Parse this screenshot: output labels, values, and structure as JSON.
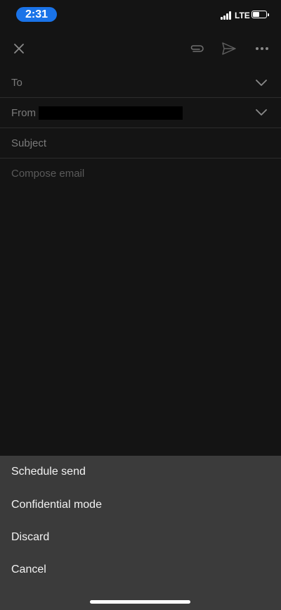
{
  "status_bar": {
    "time": "2:31",
    "network": "LTE"
  },
  "toolbar": {
    "icons": [
      "close-icon",
      "attachment-icon",
      "send-icon",
      "more-icon"
    ]
  },
  "compose": {
    "to_label": "To",
    "from_label": "From",
    "subject_placeholder": "Subject",
    "body_placeholder": "Compose email"
  },
  "action_sheet": {
    "items": [
      "Schedule send",
      "Confidential mode",
      "Discard",
      "Cancel"
    ]
  },
  "colors": {
    "accent": "#1a73e8",
    "background": "#141414",
    "sheet": "#3b3b3b"
  }
}
